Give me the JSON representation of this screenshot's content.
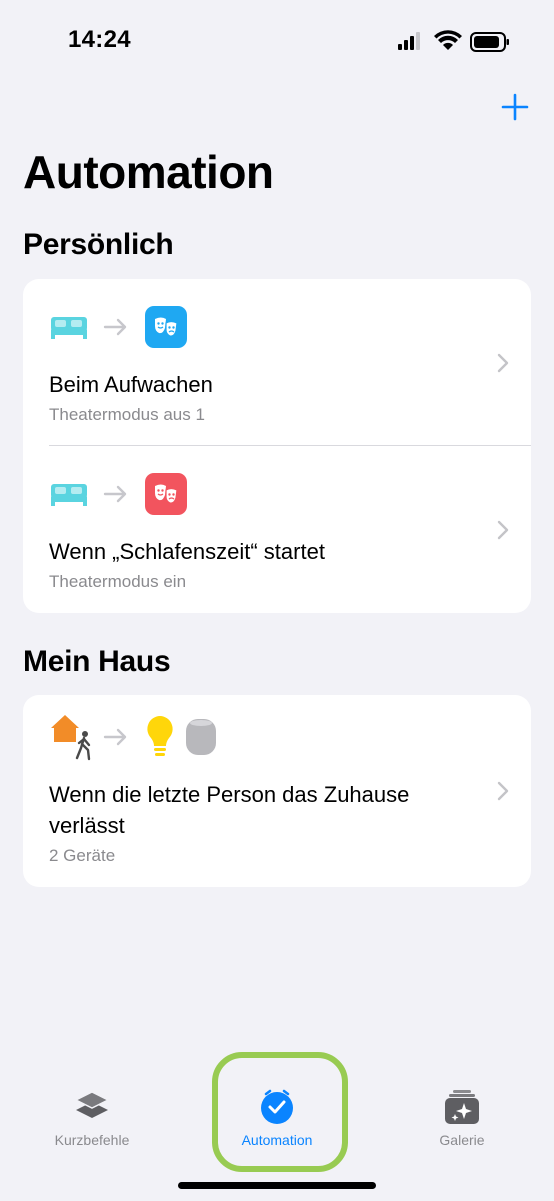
{
  "status_bar": {
    "time": "14:24",
    "icons": [
      "signal-icon",
      "wifi-icon",
      "battery-icon"
    ]
  },
  "header": {
    "add_icon": "plus-icon",
    "title": "Automation"
  },
  "sections": [
    {
      "title": "Persönlich",
      "items": [
        {
          "title": "Beim Aufwachen",
          "subtitle": "Theatermodus aus 1",
          "trigger_icon": "bed-icon",
          "action_icon": "theater-masks-icon",
          "action_color": "#1fa8f2"
        },
        {
          "title": "Wenn „Schlafenszeit“ startet",
          "subtitle": "Theatermodus ein",
          "trigger_icon": "bed-icon",
          "action_icon": "theater-masks-icon",
          "action_color": "#f2545e"
        }
      ]
    },
    {
      "title": "Mein Haus",
      "items": [
        {
          "title_line1": "Wenn die letzte Person das Zuhause",
          "title_line2": "verlässt",
          "subtitle": "2 Geräte",
          "trigger_icon": "house-person-leaving-icon",
          "action_icons": [
            "lightbulb-icon",
            "homepod-icon"
          ]
        }
      ]
    }
  ],
  "tab_bar": {
    "tabs": [
      {
        "label": "Kurzbefehle",
        "icon": "layers-icon",
        "active": false
      },
      {
        "label": "Automation",
        "icon": "clock-check-icon",
        "active": true
      },
      {
        "label": "Galerie",
        "icon": "gallery-sparkle-icon",
        "active": false
      }
    ]
  },
  "colors": {
    "accent": "#0a84ff",
    "background": "#f2f2f7",
    "bed": "#5ad4e0",
    "lightbulb": "#ffd60a",
    "house": "#f28c28",
    "highlight": "#8ec63f"
  }
}
